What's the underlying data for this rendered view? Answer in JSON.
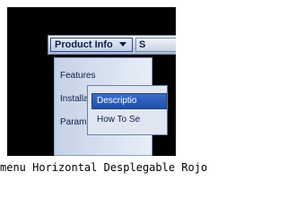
{
  "menubar": {
    "items": [
      {
        "label": "Product Info"
      },
      {
        "label": "S"
      }
    ]
  },
  "dropdown": {
    "items": [
      {
        "label": "Features"
      },
      {
        "label": "Installa"
      },
      {
        "label": "Parame"
      }
    ]
  },
  "submenu": {
    "items": [
      {
        "label": "Descriptio"
      },
      {
        "label": "How To Se"
      }
    ]
  },
  "caption": "menu Horizontal Desplegable Rojo"
}
